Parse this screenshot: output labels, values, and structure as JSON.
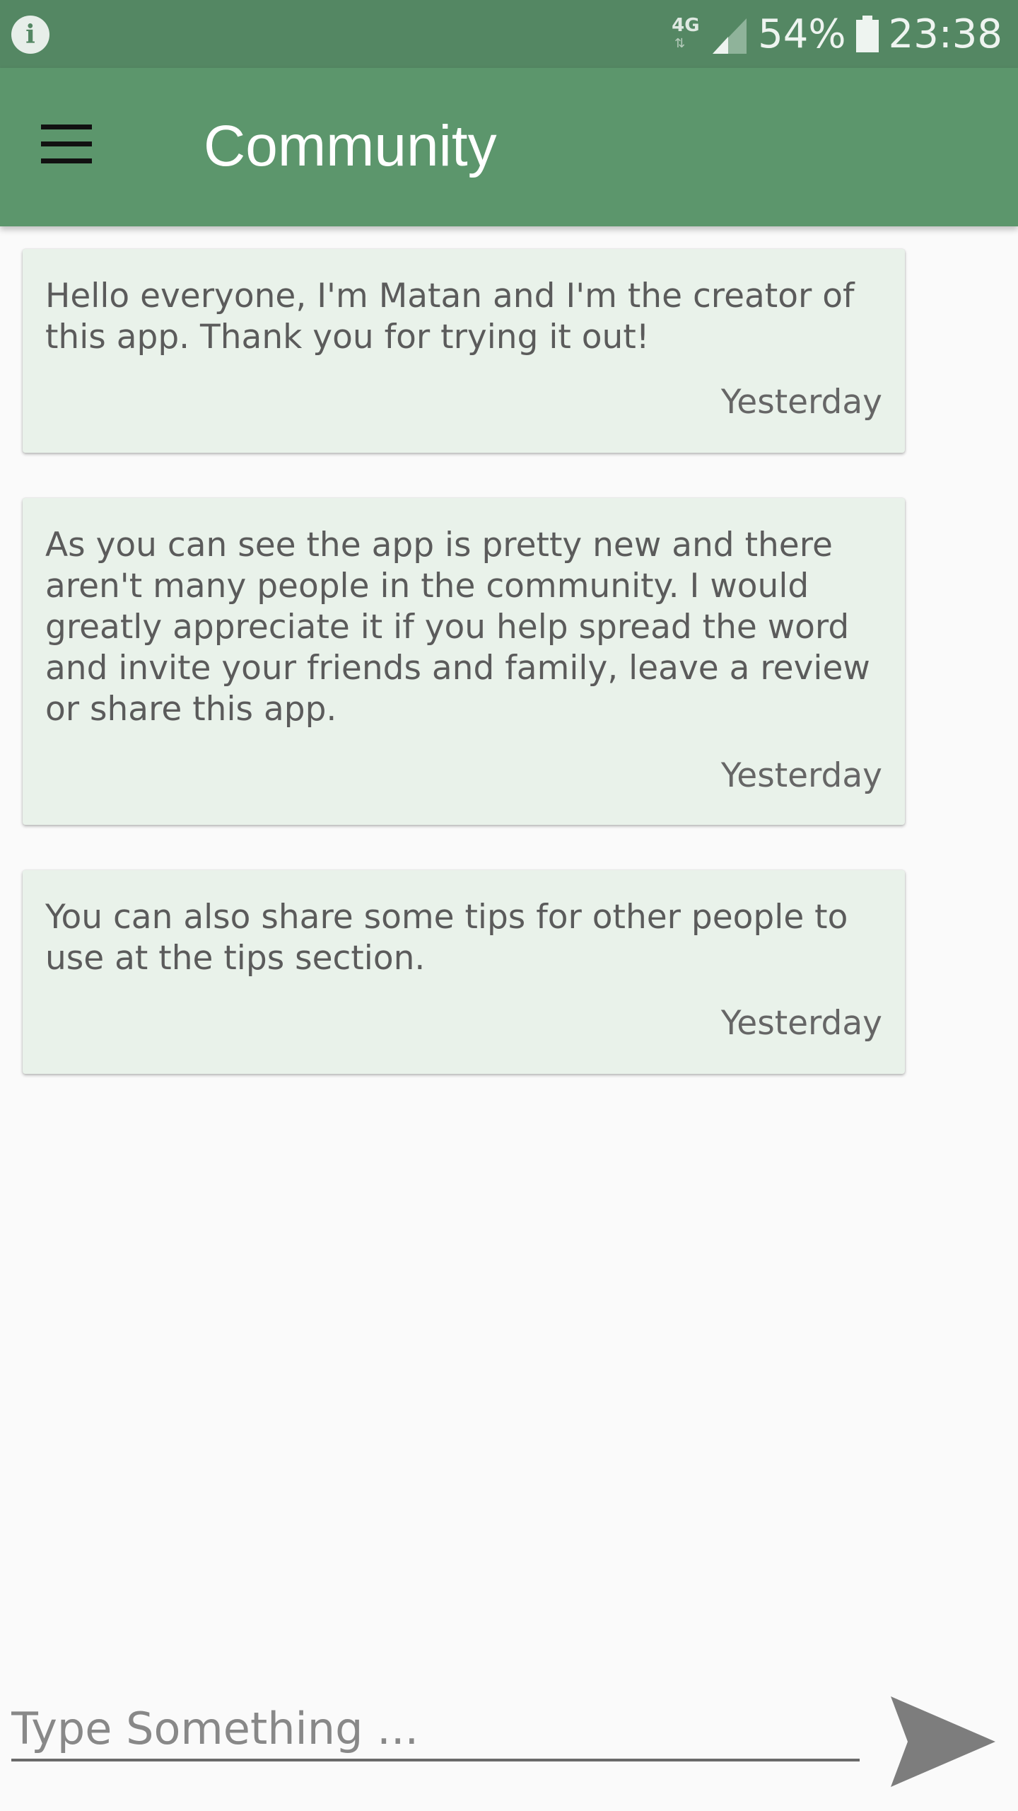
{
  "status_bar": {
    "network": "4G",
    "battery": "54%",
    "time": "23:38"
  },
  "app_bar": {
    "title": "Community"
  },
  "messages": [
    {
      "text": "Hello everyone, I'm Matan and I'm the creator of this app. Thank you for trying it out!",
      "time": "Yesterday"
    },
    {
      "text": "As you can see the app is pretty new and there aren't many people in the community. I would greatly appreciate it if you help spread the word and invite your friends and family, leave a review or share this app.",
      "time": "Yesterday"
    },
    {
      "text": "You can also share some tips for other people to use at the tips section.",
      "time": "Yesterday"
    }
  ],
  "composer": {
    "placeholder": "Type Something ..."
  },
  "icons": {
    "status_left": "info-icon",
    "menu": "hamburger-menu-icon",
    "send": "send-icon"
  },
  "colors": {
    "status_bar": "#548763",
    "app_bar": "#5c966c",
    "card_background": "#e9f2ea"
  }
}
